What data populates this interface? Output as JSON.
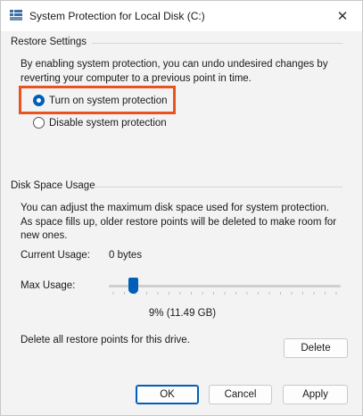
{
  "window": {
    "title": "System Protection for Local Disk (C:)",
    "close_glyph": "✕"
  },
  "restore": {
    "group_label": "Restore Settings",
    "description": "By enabling system protection, you can undo undesired changes by reverting your computer to a previous point in time.",
    "options": [
      {
        "label": "Turn on system protection",
        "checked": true
      },
      {
        "label": "Disable system protection",
        "checked": false
      }
    ],
    "highlight_color": "#e8531f"
  },
  "disk": {
    "group_label": "Disk Space Usage",
    "description": "You can adjust the maximum disk space used for system protection. As space fills up, older restore points will be deleted to make room for new ones.",
    "current_usage_label": "Current Usage:",
    "current_usage_value": "0 bytes",
    "max_usage_label": "Max Usage:",
    "max_usage_fraction": 0.09,
    "max_usage_readout": "9% (11.49 GB)",
    "delete_text": "Delete all restore points for this drive.",
    "delete_button": "Delete"
  },
  "footer": {
    "ok": "OK",
    "cancel": "Cancel",
    "apply": "Apply"
  },
  "colors": {
    "accent": "#005fb8",
    "highlight": "#e8531f"
  },
  "icons": {
    "app": "system-protection-icon",
    "close": "close-icon",
    "slider_thumb": "slider-thumb"
  }
}
